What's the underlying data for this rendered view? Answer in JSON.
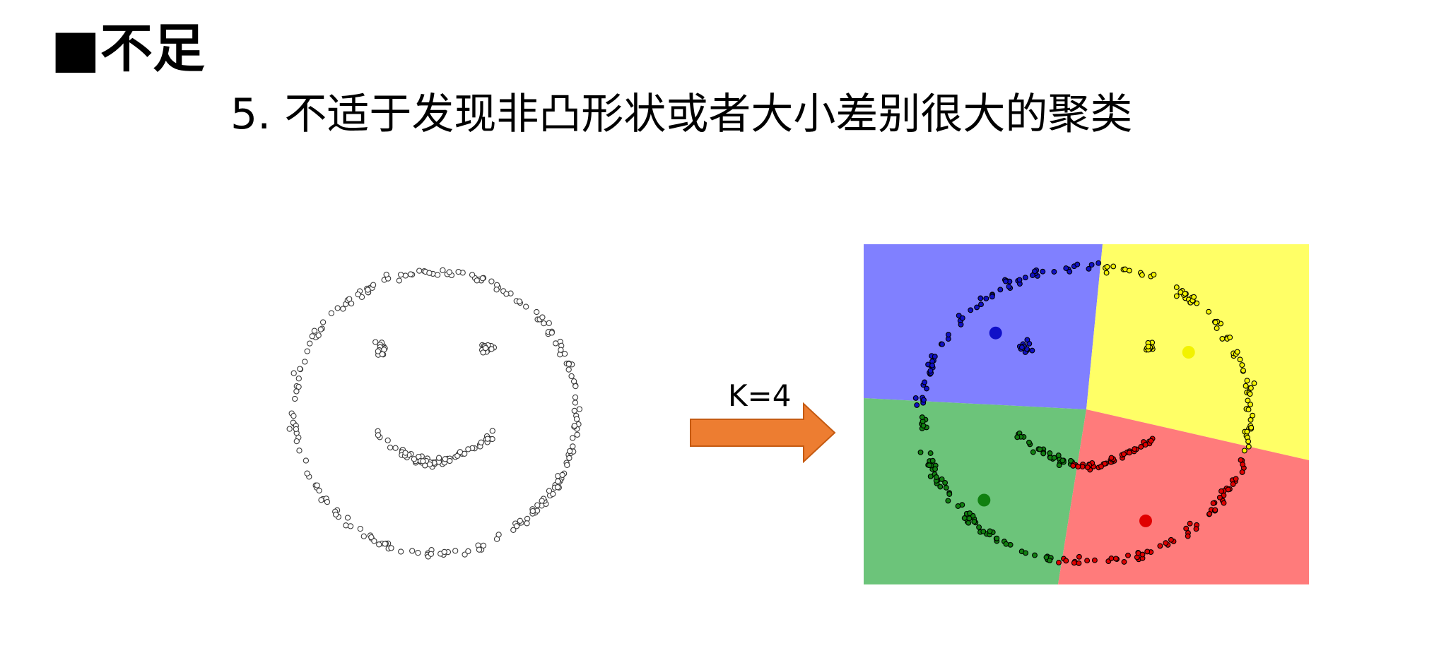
{
  "slide": {
    "heading": "■不足",
    "subtitle": "5. 不适于发现非凸形状或者大小差别很大的聚类",
    "k_label": "K=4"
  },
  "colors": {
    "arrow_fill": "#ED7D31",
    "arrow_stroke": "#C55A11",
    "region_blue": "#8080FF",
    "region_yellow": "#FFFF66",
    "region_green": "#6CC47A",
    "region_red": "#FF7B7B",
    "point_blue": "#1010C8",
    "point_yellow": "#F2F200",
    "point_green": "#108010",
    "point_red": "#E00000"
  },
  "chart_data": [
    {
      "type": "scatter",
      "title": "",
      "description_points": "unlabeled smiley-face shaped point cloud (raw data before clustering)",
      "xlim": [
        -1.1,
        1.1
      ],
      "ylim": [
        -1.1,
        1.1
      ],
      "grid": false,
      "series": [
        {
          "name": "",
          "shape": "face-ring",
          "center": [
            0,
            0
          ],
          "radius": 1.0,
          "count": 220
        },
        {
          "name": "",
          "shape": "eye-left",
          "center": [
            -0.38,
            0.45
          ],
          "radius": 0.07,
          "count": 18
        },
        {
          "name": "",
          "shape": "eye-right",
          "center": [
            0.38,
            0.45
          ],
          "radius": 0.07,
          "count": 14
        },
        {
          "name": "",
          "shape": "mouth",
          "center": [
            0.0,
            -0.15
          ],
          "radius": 0.45,
          "count": 70
        }
      ]
    },
    {
      "type": "scatter",
      "title": "",
      "xlim": [
        -1.35,
        1.35
      ],
      "ylim": [
        -1.15,
        1.15
      ],
      "grid": false,
      "centroids": [
        {
          "cluster": "blue",
          "x": -0.55,
          "y": 0.55
        },
        {
          "cluster": "yellow",
          "x": 0.62,
          "y": 0.42
        },
        {
          "cluster": "green",
          "x": -0.62,
          "y": -0.58
        },
        {
          "cluster": "red",
          "x": 0.36,
          "y": -0.72
        }
      ],
      "clusters": [
        {
          "name": "",
          "color_key": "point_blue",
          "count": 95
        },
        {
          "name": "",
          "color_key": "point_yellow",
          "count": 90
        },
        {
          "name": "",
          "color_key": "point_green",
          "count": 105
        },
        {
          "name": "",
          "color_key": "point_red",
          "count": 115
        }
      ]
    }
  ]
}
